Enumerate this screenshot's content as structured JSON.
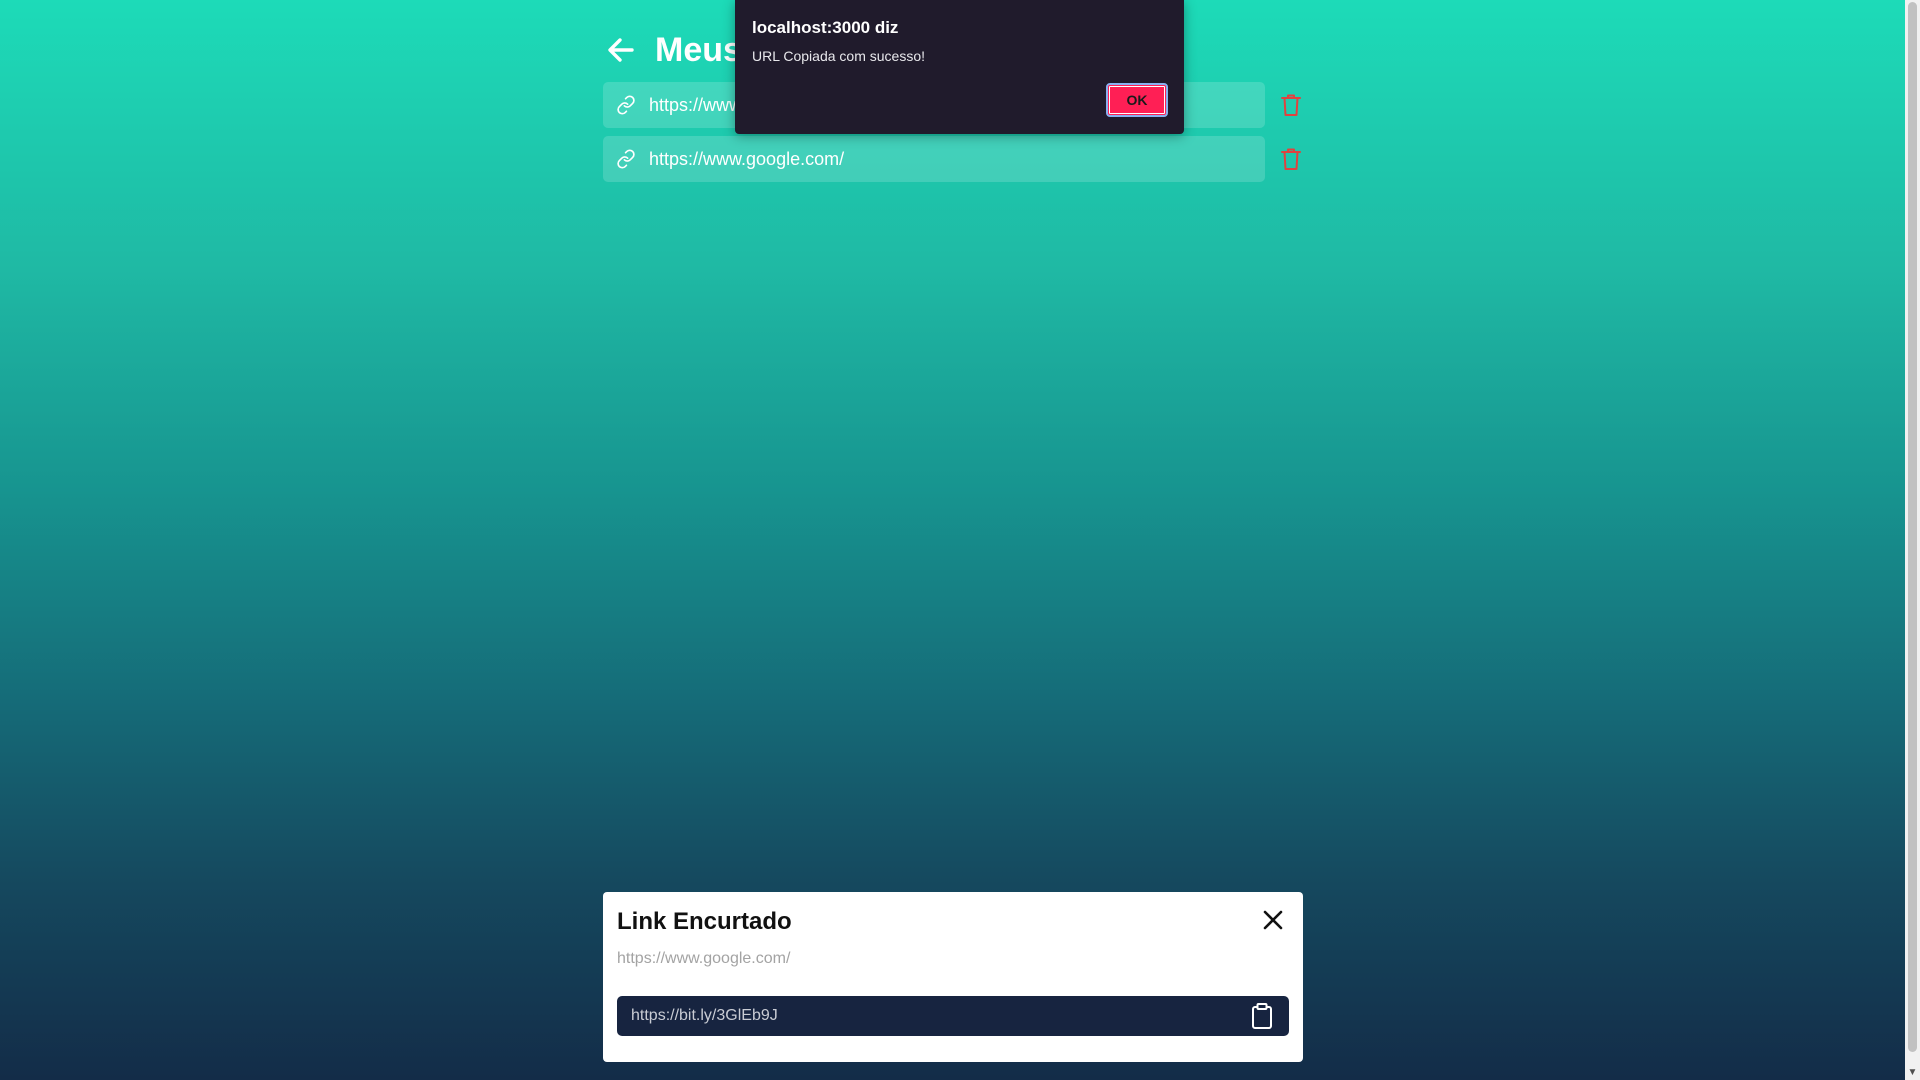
{
  "header": {
    "title": "Meus Links"
  },
  "links": [
    {
      "url": "https://www.google.com/"
    },
    {
      "url": "https://www.google.com/"
    }
  ],
  "alert": {
    "title": "localhost:3000 diz",
    "message": "URL Copiada com sucesso!",
    "ok_label": "OK"
  },
  "modal": {
    "title": "Link Encurtado",
    "original_url": "https://www.google.com/",
    "short_url": "https://bit.ly/3GlEb9J"
  },
  "colors": {
    "accent_button": "#ff1f55",
    "trash": "#e0433f",
    "short_box": "#172440"
  },
  "icons": {
    "back": "arrow-left-icon",
    "link": "link-icon",
    "delete": "trash-icon",
    "close": "close-icon",
    "copy": "clipboard-icon"
  }
}
